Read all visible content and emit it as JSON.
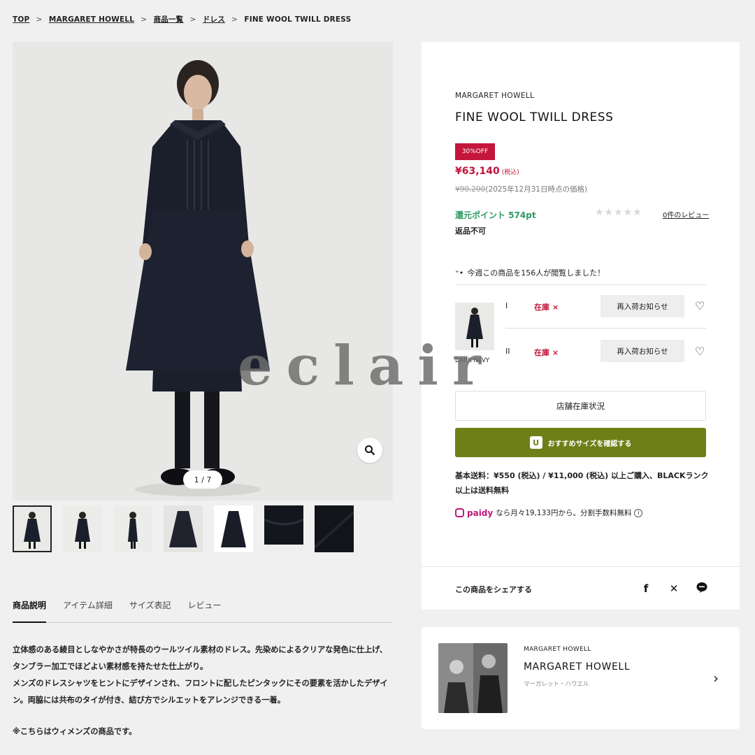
{
  "breadcrumb": {
    "items": [
      "TOP",
      "MARGARET HOWELL",
      "商品一覧",
      "ドレス"
    ],
    "current": "FINE WOOL TWILL DRESS",
    "separator": ">"
  },
  "gallery": {
    "counter": "1 / 7",
    "zoom_icon": "search-icon"
  },
  "tabs": [
    "商品説明",
    "アイテム詳細",
    "サイズ表記",
    "レビュー"
  ],
  "description": {
    "p1": "立体感のある綾目としなやかさが特長のウールツイル素材のドレス。先染めによるクリアな発色に仕上げ、タンブラー加工でほどよい素材感を持たせた仕上がり。",
    "p2": "メンズのドレスシャツをヒントにデザインされ、フロントに配したピンタックにその要素を活かしたデザイン。両脇には共布のタイが付き、結び方でシルエットをアレンジできる一着。",
    "note": "※こちらはウィメンズの商品です。"
  },
  "product": {
    "brand": "MARGARET HOWELL",
    "title": "FINE WOOL TWILL DRESS",
    "badge": "30%OFF",
    "price": "¥63,140",
    "price_tax": "(税込)",
    "orig_price": "¥90,200",
    "orig_note": "(2025年12月31日時点の価格)",
    "points": "還元ポイント 574pt",
    "stars": "★★★★★",
    "review_link": "0件のレビュー",
    "no_return": "返品不可",
    "views": "今週この商品を156人が閲覧しました！",
    "variant_name": "DARK NAVY",
    "sizes": [
      {
        "size": "I",
        "stock": "在庫 ×",
        "button": "再入荷お知らせ"
      },
      {
        "size": "II",
        "stock": "在庫 ×",
        "button": "再入荷お知らせ"
      }
    ],
    "store_stock": "店舗在庫状況",
    "size_recommend": "おすすめサイズを確認する",
    "shipping": "基本送料：¥550 (税込) / ¥11,000 (税込) 以上ご購入、BLACKランク以上は送料無料",
    "paidy_logo": "paidy",
    "paidy_text": "なら月々19,133円から。分割手数料無料"
  },
  "share": {
    "label": "この商品をシェアする",
    "icons": [
      "facebook-icon",
      "x-icon",
      "line-icon"
    ]
  },
  "brand_card": {
    "small": "MARGARET HOWELL",
    "name": "MARGARET HOWELL",
    "kana": "マーガレット・ハウエル"
  },
  "watermark": "eclair",
  "colors": {
    "sale_red": "#c4153b",
    "points_green": "#2e9a64",
    "cta_olive": "#6f7f18",
    "paidy_magenta": "#c0177b"
  }
}
